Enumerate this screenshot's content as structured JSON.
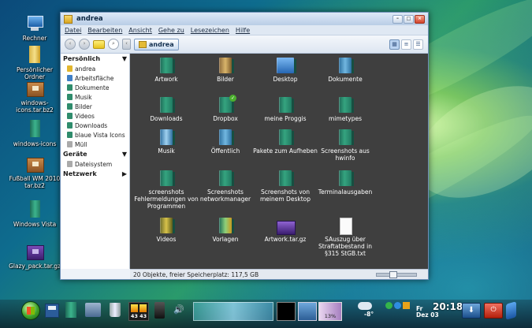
{
  "desktop": {
    "icons": [
      {
        "label": "Rechner",
        "icon": "computer-icon"
      },
      {
        "label": "Persönlicher Ordner",
        "icon": "home-folder-icon"
      },
      {
        "label": "windows-icons.tar.bz2",
        "icon": "archive-icon"
      },
      {
        "label": "windows-icons",
        "icon": "folder-icon"
      },
      {
        "label": "Fußball WM 2010 tar.bz2",
        "icon": "archive-icon"
      },
      {
        "label": "Windows Vista",
        "icon": "folder-icon"
      },
      {
        "label": "Glazy_pack.tar.gz",
        "icon": "archive-icon"
      }
    ]
  },
  "window": {
    "title": "andrea",
    "menu": [
      "Datei",
      "Bearbeiten",
      "Ansicht",
      "Gehe zu",
      "Lesezeichen",
      "Hilfe"
    ],
    "location": "andrea",
    "sidebar": {
      "personal_header": "Persönlich",
      "personal_items": [
        "andrea",
        "Arbeitsfläche",
        "Dokumente",
        "Musik",
        "Bilder",
        "Videos",
        "Downloads",
        "blaue Vista Icons",
        "Müll"
      ],
      "devices_header": "Geräte",
      "device_items": [
        "Dateisystem"
      ],
      "network_header": "Netzwerk"
    },
    "files": [
      {
        "name": "Artwork",
        "icon": "folder-icon"
      },
      {
        "name": "Bilder",
        "icon": "pictures-folder-icon"
      },
      {
        "name": "Desktop",
        "icon": "desktop-folder-icon"
      },
      {
        "name": "Dokumente",
        "icon": "documents-folder-icon"
      },
      {
        "name": "Downloads",
        "icon": "downloads-folder-icon"
      },
      {
        "name": "Dropbox",
        "icon": "dropbox-folder-icon"
      },
      {
        "name": "meine Proggis",
        "icon": "folder-icon"
      },
      {
        "name": "mimetypes",
        "icon": "folder-icon"
      },
      {
        "name": "Musik",
        "icon": "music-folder-icon"
      },
      {
        "name": "Öffentlich",
        "icon": "public-folder-icon"
      },
      {
        "name": "Pakete zum Aufheben",
        "icon": "folder-icon"
      },
      {
        "name": "Screenshots aus hwinfo",
        "icon": "folder-icon"
      },
      {
        "name": "screenshots Fehlermeldungen von Programmen",
        "icon": "folder-icon"
      },
      {
        "name": "Screenshots networkmanager",
        "icon": "folder-icon"
      },
      {
        "name": "Screenshots von meinem Desktop",
        "icon": "folder-icon"
      },
      {
        "name": "Terminalausgaben",
        "icon": "folder-icon"
      },
      {
        "name": "Videos",
        "icon": "videos-folder-icon"
      },
      {
        "name": "Vorlagen",
        "icon": "templates-folder-icon"
      },
      {
        "name": "Artwork.tar.gz",
        "icon": "archive-icon"
      },
      {
        "name": "SAuszug über Straftatbestand in §315 StGB.txt",
        "icon": "text-file-icon"
      }
    ],
    "status": "20 Objekte, freier Speicherplatz: 117,5 GB"
  },
  "taskbar": {
    "cpu_label": "43 43",
    "percent_label": "13%",
    "temp_label": "-8°",
    "clock_time": "20:18",
    "clock_day": "Fr",
    "clock_date": "Dez 03"
  },
  "colors": {
    "folder_teal": "#2a8f70",
    "content_bg": "#3f3f3f",
    "window_chrome": "#c7d8ec"
  }
}
